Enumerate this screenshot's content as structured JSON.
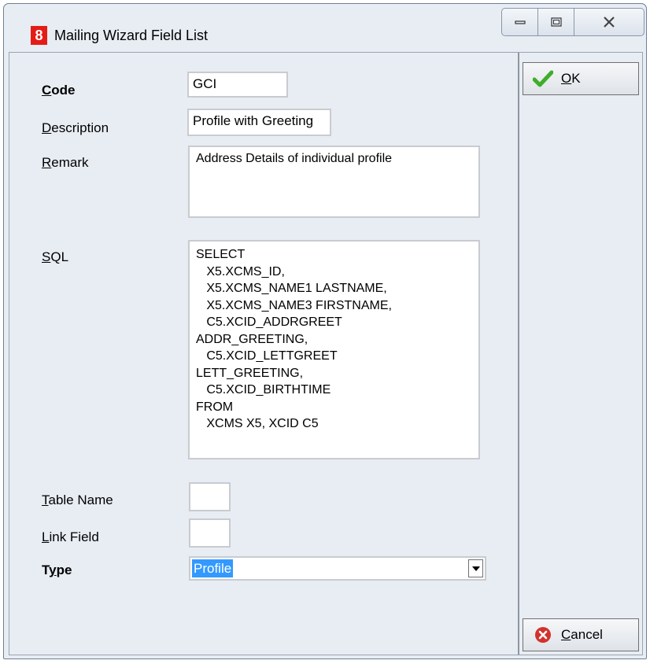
{
  "window": {
    "title": "Mailing Wizard Field List",
    "app_icon_glyph": "8",
    "app_icon_color": "#e41c16",
    "caption_buttons": [
      "minimize-icon",
      "maximize-icon",
      "close-icon"
    ]
  },
  "form": {
    "code": {
      "label_pre": "",
      "label_u": "C",
      "label_post": "ode",
      "value": "GCI"
    },
    "description": {
      "label_pre": "",
      "label_u": "D",
      "label_post": "escription",
      "value": "Profile with Greeting"
    },
    "remark": {
      "label_pre": "",
      "label_u": "R",
      "label_post": "emark",
      "value": "Address Details of individual profile"
    },
    "sql": {
      "label_pre": "",
      "label_u": "S",
      "label_post": "QL",
      "lines": [
        "SELECT",
        "   X5.XCMS_ID,",
        "   X5.XCMS_NAME1 LASTNAME,",
        "   X5.XCMS_NAME3 FIRSTNAME,",
        "   C5.XCID_ADDRGREET",
        "ADDR_GREETING,",
        "   C5.XCID_LETTGREET",
        "LETT_GREETING,",
        "   C5.XCID_BIRTHTIME",
        "FROM",
        "   XCMS X5, XCID C5"
      ]
    },
    "table_name": {
      "label_pre": "",
      "label_u": "T",
      "label_post": "able Name",
      "value": ""
    },
    "link_field": {
      "label_pre": "",
      "label_u": "L",
      "label_post": "ink Field",
      "value": ""
    },
    "type": {
      "label_pre": "T",
      "label_u": "y",
      "label_post": "pe",
      "value": "Profile"
    }
  },
  "buttons": {
    "ok": {
      "label_u": "O",
      "label_post": "K",
      "icon": "checkmark-icon",
      "color": "#3fae29"
    },
    "cancel": {
      "label_u": "C",
      "label_post": "ancel",
      "icon": "cancel-icon",
      "color": "#d2322d"
    }
  }
}
